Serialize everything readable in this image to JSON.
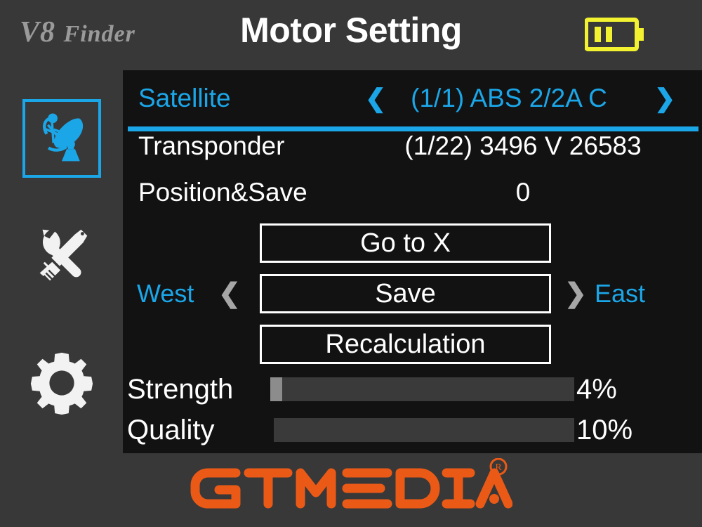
{
  "header": {
    "brand_primary": "V8",
    "brand_secondary": "Finder",
    "title": "Motor Setting",
    "battery_icon": "battery-icon",
    "battery_bars": 2,
    "battery_color": "#f2f230"
  },
  "sidebar": {
    "items": [
      {
        "name": "satellite",
        "icon": "satellite-dish-icon",
        "selected": true
      },
      {
        "name": "tools",
        "icon": "tools-icon",
        "selected": false
      },
      {
        "name": "settings",
        "icon": "gear-icon",
        "selected": false
      }
    ]
  },
  "main": {
    "rows": [
      {
        "label": "Satellite",
        "value": "(1/1) ABS 2/2A C",
        "prev_icon": "❮",
        "next_icon": "❯",
        "selected": true
      },
      {
        "label": "Transponder",
        "value": "(1/22) 3496 V 26583",
        "selected": false
      },
      {
        "label": "Position&Save",
        "value": "0",
        "selected": false
      }
    ],
    "buttons": {
      "goto": "Go to X",
      "save": "Save",
      "recalculation": "Recalculation"
    },
    "direction": {
      "west_label": "West",
      "west_icon": "❮",
      "east_icon": "❯",
      "east_label": "East"
    },
    "meters": [
      {
        "label": "Strength",
        "percent": 4,
        "percent_text": "4%"
      },
      {
        "label": "Quality",
        "percent": 0,
        "percent_text": "10%"
      }
    ]
  },
  "footer": {
    "logo_text": "GTMEDIA",
    "trademark": "®",
    "logo_color": "#ea5a16"
  },
  "colors": {
    "accent": "#1ba6e8",
    "panel": "#383838",
    "screen": "#121212",
    "text": "#ffffff",
    "muted": "#9a9a9a",
    "bar_fill": "#8c8c8c",
    "bar_track": "#3a3a3a"
  }
}
